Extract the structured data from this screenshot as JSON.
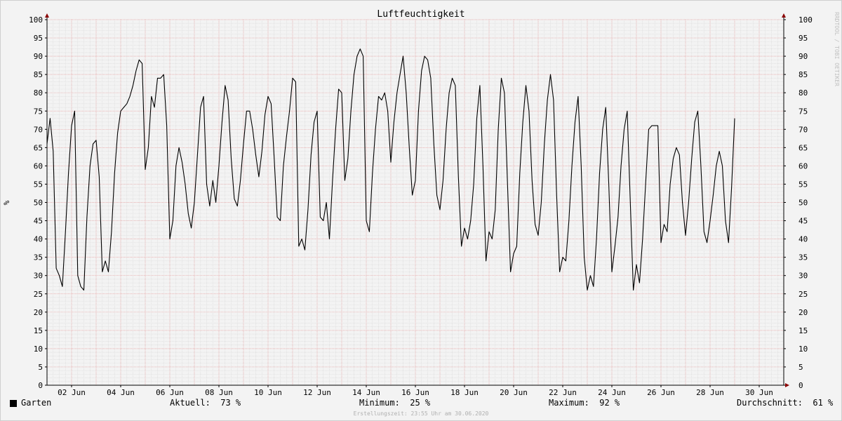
{
  "chart_data": {
    "type": "line",
    "title": "Luftfeuchtigkeit",
    "ylabel": "%",
    "watermark": "RRDTOOL / TOBI OETIKER",
    "ylim": [
      0,
      100
    ],
    "yticks": [
      0,
      5,
      10,
      15,
      20,
      25,
      30,
      35,
      40,
      45,
      50,
      55,
      60,
      65,
      70,
      75,
      80,
      85,
      90,
      95,
      100
    ],
    "xlim": [
      "2020-06-01 00:00",
      "2020-07-01 00:00"
    ],
    "xticks": [
      {
        "date": "2020-06-02",
        "label": "02 Jun"
      },
      {
        "date": "2020-06-04",
        "label": "04 Jun"
      },
      {
        "date": "2020-06-06",
        "label": "06 Jun"
      },
      {
        "date": "2020-06-08",
        "label": "08 Jun"
      },
      {
        "date": "2020-06-10",
        "label": "10 Jun"
      },
      {
        "date": "2020-06-12",
        "label": "12 Jun"
      },
      {
        "date": "2020-06-14",
        "label": "14 Jun"
      },
      {
        "date": "2020-06-16",
        "label": "16 Jun"
      },
      {
        "date": "2020-06-18",
        "label": "18 Jun"
      },
      {
        "date": "2020-06-20",
        "label": "20 Jun"
      },
      {
        "date": "2020-06-22",
        "label": "22 Jun"
      },
      {
        "date": "2020-06-24",
        "label": "24 Jun"
      },
      {
        "date": "2020-06-26",
        "label": "26 Jun"
      },
      {
        "date": "2020-06-28",
        "label": "28 Jun"
      },
      {
        "date": "2020-06-30",
        "label": "30 Jun"
      }
    ],
    "grid": true,
    "colors": {
      "line": "#000000",
      "minor_grid": "#d8d8d8",
      "major_grid": "#e8a0a0",
      "arrow": "#8b0000"
    },
    "series": [
      {
        "name": "Garten",
        "points": [
          [
            "2020-06-01 00:00",
            66
          ],
          [
            "2020-06-01 03:00",
            73
          ],
          [
            "2020-06-01 06:00",
            64
          ],
          [
            "2020-06-01 09:00",
            32
          ],
          [
            "2020-06-01 12:00",
            30
          ],
          [
            "2020-06-01 15:00",
            27
          ],
          [
            "2020-06-01 18:00",
            42
          ],
          [
            "2020-06-01 21:00",
            58
          ],
          [
            "2020-06-02 00:00",
            71
          ],
          [
            "2020-06-02 03:00",
            75
          ],
          [
            "2020-06-02 06:00",
            30
          ],
          [
            "2020-06-02 09:00",
            27
          ],
          [
            "2020-06-02 12:00",
            26
          ],
          [
            "2020-06-02 15:00",
            46
          ],
          [
            "2020-06-02 18:00",
            60
          ],
          [
            "2020-06-02 21:00",
            66
          ],
          [
            "2020-06-03 00:00",
            67
          ],
          [
            "2020-06-03 03:00",
            57
          ],
          [
            "2020-06-03 06:00",
            31
          ],
          [
            "2020-06-03 09:00",
            34
          ],
          [
            "2020-06-03 12:00",
            31
          ],
          [
            "2020-06-03 15:00",
            42
          ],
          [
            "2020-06-03 18:00",
            58
          ],
          [
            "2020-06-03 21:00",
            69
          ],
          [
            "2020-06-04 00:00",
            75
          ],
          [
            "2020-06-04 03:00",
            76
          ],
          [
            "2020-06-04 06:00",
            77
          ],
          [
            "2020-06-04 09:00",
            79
          ],
          [
            "2020-06-04 12:00",
            82
          ],
          [
            "2020-06-04 15:00",
            86
          ],
          [
            "2020-06-04 18:00",
            89
          ],
          [
            "2020-06-04 21:00",
            88
          ],
          [
            "2020-06-05 00:00",
            59
          ],
          [
            "2020-06-05 03:00",
            65
          ],
          [
            "2020-06-05 06:00",
            79
          ],
          [
            "2020-06-05 09:00",
            76
          ],
          [
            "2020-06-05 12:00",
            84
          ],
          [
            "2020-06-05 15:00",
            84
          ],
          [
            "2020-06-05 18:00",
            85
          ],
          [
            "2020-06-05 21:00",
            71
          ],
          [
            "2020-06-06 00:00",
            40
          ],
          [
            "2020-06-06 03:00",
            45
          ],
          [
            "2020-06-06 06:00",
            60
          ],
          [
            "2020-06-06 09:00",
            65
          ],
          [
            "2020-06-06 12:00",
            61
          ],
          [
            "2020-06-06 15:00",
            55
          ],
          [
            "2020-06-06 18:00",
            47
          ],
          [
            "2020-06-06 21:00",
            43
          ],
          [
            "2020-06-07 00:00",
            50
          ],
          [
            "2020-06-07 03:00",
            63
          ],
          [
            "2020-06-07 06:00",
            76
          ],
          [
            "2020-06-07 09:00",
            79
          ],
          [
            "2020-06-07 12:00",
            55
          ],
          [
            "2020-06-07 15:00",
            49
          ],
          [
            "2020-06-07 18:00",
            56
          ],
          [
            "2020-06-07 21:00",
            50
          ],
          [
            "2020-06-08 00:00",
            60
          ],
          [
            "2020-06-08 03:00",
            72
          ],
          [
            "2020-06-08 06:00",
            82
          ],
          [
            "2020-06-08 09:00",
            78
          ],
          [
            "2020-06-08 12:00",
            62
          ],
          [
            "2020-06-08 15:00",
            51
          ],
          [
            "2020-06-08 18:00",
            49
          ],
          [
            "2020-06-08 21:00",
            56
          ],
          [
            "2020-06-09 00:00",
            66
          ],
          [
            "2020-06-09 03:00",
            75
          ],
          [
            "2020-06-09 06:00",
            75
          ],
          [
            "2020-06-09 09:00",
            70
          ],
          [
            "2020-06-09 12:00",
            63
          ],
          [
            "2020-06-09 15:00",
            57
          ],
          [
            "2020-06-09 18:00",
            64
          ],
          [
            "2020-06-09 21:00",
            74
          ],
          [
            "2020-06-10 00:00",
            79
          ],
          [
            "2020-06-10 03:00",
            77
          ],
          [
            "2020-06-10 06:00",
            62
          ],
          [
            "2020-06-10 09:00",
            46
          ],
          [
            "2020-06-10 12:00",
            45
          ],
          [
            "2020-06-10 15:00",
            60
          ],
          [
            "2020-06-10 18:00",
            68
          ],
          [
            "2020-06-10 21:00",
            75
          ],
          [
            "2020-06-11 00:00",
            84
          ],
          [
            "2020-06-11 03:00",
            83
          ],
          [
            "2020-06-11 06:00",
            38
          ],
          [
            "2020-06-11 09:00",
            40
          ],
          [
            "2020-06-11 12:00",
            37
          ],
          [
            "2020-06-11 15:00",
            48
          ],
          [
            "2020-06-11 18:00",
            63
          ],
          [
            "2020-06-11 21:00",
            72
          ],
          [
            "2020-06-12 00:00",
            75
          ],
          [
            "2020-06-12 03:00",
            46
          ],
          [
            "2020-06-12 06:00",
            45
          ],
          [
            "2020-06-12 09:00",
            50
          ],
          [
            "2020-06-12 12:00",
            40
          ],
          [
            "2020-06-12 15:00",
            56
          ],
          [
            "2020-06-12 18:00",
            70
          ],
          [
            "2020-06-12 21:00",
            81
          ],
          [
            "2020-06-13 00:00",
            80
          ],
          [
            "2020-06-13 03:00",
            56
          ],
          [
            "2020-06-13 06:00",
            62
          ],
          [
            "2020-06-13 09:00",
            75
          ],
          [
            "2020-06-13 12:00",
            85
          ],
          [
            "2020-06-13 15:00",
            90
          ],
          [
            "2020-06-13 18:00",
            92
          ],
          [
            "2020-06-13 21:00",
            90
          ],
          [
            "2020-06-14 00:00",
            45
          ],
          [
            "2020-06-14 03:00",
            42
          ],
          [
            "2020-06-14 06:00",
            58
          ],
          [
            "2020-06-14 09:00",
            70
          ],
          [
            "2020-06-14 12:00",
            79
          ],
          [
            "2020-06-14 15:00",
            78
          ],
          [
            "2020-06-14 18:00",
            80
          ],
          [
            "2020-06-14 21:00",
            75
          ],
          [
            "2020-06-15 00:00",
            61
          ],
          [
            "2020-06-15 03:00",
            72
          ],
          [
            "2020-06-15 06:00",
            80
          ],
          [
            "2020-06-15 09:00",
            85
          ],
          [
            "2020-06-15 12:00",
            90
          ],
          [
            "2020-06-15 15:00",
            80
          ],
          [
            "2020-06-15 18:00",
            65
          ],
          [
            "2020-06-15 21:00",
            52
          ],
          [
            "2020-06-16 00:00",
            56
          ],
          [
            "2020-06-16 03:00",
            75
          ],
          [
            "2020-06-16 06:00",
            86
          ],
          [
            "2020-06-16 09:00",
            90
          ],
          [
            "2020-06-16 12:00",
            89
          ],
          [
            "2020-06-16 15:00",
            84
          ],
          [
            "2020-06-16 18:00",
            66
          ],
          [
            "2020-06-16 21:00",
            52
          ],
          [
            "2020-06-17 00:00",
            48
          ],
          [
            "2020-06-17 03:00",
            56
          ],
          [
            "2020-06-17 06:00",
            70
          ],
          [
            "2020-06-17 09:00",
            80
          ],
          [
            "2020-06-17 12:00",
            84
          ],
          [
            "2020-06-17 15:00",
            82
          ],
          [
            "2020-06-17 18:00",
            57
          ],
          [
            "2020-06-17 21:00",
            38
          ],
          [
            "2020-06-18 00:00",
            43
          ],
          [
            "2020-06-18 03:00",
            40
          ],
          [
            "2020-06-18 06:00",
            45
          ],
          [
            "2020-06-18 09:00",
            55
          ],
          [
            "2020-06-18 12:00",
            73
          ],
          [
            "2020-06-18 15:00",
            82
          ],
          [
            "2020-06-18 18:00",
            60
          ],
          [
            "2020-06-18 21:00",
            34
          ],
          [
            "2020-06-19 00:00",
            42
          ],
          [
            "2020-06-19 03:00",
            40
          ],
          [
            "2020-06-19 06:00",
            48
          ],
          [
            "2020-06-19 09:00",
            70
          ],
          [
            "2020-06-19 12:00",
            84
          ],
          [
            "2020-06-19 15:00",
            80
          ],
          [
            "2020-06-19 18:00",
            55
          ],
          [
            "2020-06-19 21:00",
            31
          ],
          [
            "2020-06-20 00:00",
            36
          ],
          [
            "2020-06-20 03:00",
            38
          ],
          [
            "2020-06-20 06:00",
            58
          ],
          [
            "2020-06-20 09:00",
            72
          ],
          [
            "2020-06-20 12:00",
            82
          ],
          [
            "2020-06-20 15:00",
            75
          ],
          [
            "2020-06-20 18:00",
            56
          ],
          [
            "2020-06-20 21:00",
            44
          ],
          [
            "2020-06-21 00:00",
            41
          ],
          [
            "2020-06-21 03:00",
            50
          ],
          [
            "2020-06-21 06:00",
            66
          ],
          [
            "2020-06-21 09:00",
            78
          ],
          [
            "2020-06-21 12:00",
            85
          ],
          [
            "2020-06-21 15:00",
            78
          ],
          [
            "2020-06-21 18:00",
            52
          ],
          [
            "2020-06-21 21:00",
            31
          ],
          [
            "2020-06-22 00:00",
            35
          ],
          [
            "2020-06-22 03:00",
            34
          ],
          [
            "2020-06-22 06:00",
            45
          ],
          [
            "2020-06-22 09:00",
            60
          ],
          [
            "2020-06-22 12:00",
            72
          ],
          [
            "2020-06-22 15:00",
            79
          ],
          [
            "2020-06-22 18:00",
            60
          ],
          [
            "2020-06-22 21:00",
            35
          ],
          [
            "2020-06-23 00:00",
            26
          ],
          [
            "2020-06-23 03:00",
            30
          ],
          [
            "2020-06-23 06:00",
            27
          ],
          [
            "2020-06-23 09:00",
            40
          ],
          [
            "2020-06-23 12:00",
            58
          ],
          [
            "2020-06-23 15:00",
            70
          ],
          [
            "2020-06-23 18:00",
            76
          ],
          [
            "2020-06-23 21:00",
            55
          ],
          [
            "2020-06-24 00:00",
            31
          ],
          [
            "2020-06-24 03:00",
            38
          ],
          [
            "2020-06-24 06:00",
            46
          ],
          [
            "2020-06-24 09:00",
            60
          ],
          [
            "2020-06-24 12:00",
            70
          ],
          [
            "2020-06-24 15:00",
            75
          ],
          [
            "2020-06-24 18:00",
            50
          ],
          [
            "2020-06-24 21:00",
            26
          ],
          [
            "2020-06-25 00:00",
            33
          ],
          [
            "2020-06-25 03:00",
            28
          ],
          [
            "2020-06-25 06:00",
            40
          ],
          [
            "2020-06-25 09:00",
            55
          ],
          [
            "2020-06-25 12:00",
            70
          ],
          [
            "2020-06-25 15:00",
            71
          ],
          [
            "2020-06-25 18:00",
            71
          ],
          [
            "2020-06-25 21:00",
            71
          ],
          [
            "2020-06-26 00:00",
            39
          ],
          [
            "2020-06-26 03:00",
            44
          ],
          [
            "2020-06-26 06:00",
            42
          ],
          [
            "2020-06-26 09:00",
            55
          ],
          [
            "2020-06-26 12:00",
            62
          ],
          [
            "2020-06-26 15:00",
            65
          ],
          [
            "2020-06-26 18:00",
            63
          ],
          [
            "2020-06-26 21:00",
            50
          ],
          [
            "2020-06-27 00:00",
            41
          ],
          [
            "2020-06-27 03:00",
            50
          ],
          [
            "2020-06-27 06:00",
            62
          ],
          [
            "2020-06-27 09:00",
            72
          ],
          [
            "2020-06-27 12:00",
            75
          ],
          [
            "2020-06-27 15:00",
            60
          ],
          [
            "2020-06-27 18:00",
            42
          ],
          [
            "2020-06-27 21:00",
            39
          ],
          [
            "2020-06-28 00:00",
            45
          ],
          [
            "2020-06-28 03:00",
            52
          ],
          [
            "2020-06-28 06:00",
            60
          ],
          [
            "2020-06-28 09:00",
            64
          ],
          [
            "2020-06-28 12:00",
            60
          ],
          [
            "2020-06-28 15:00",
            45
          ],
          [
            "2020-06-28 18:00",
            39
          ],
          [
            "2020-06-28 21:00",
            54
          ],
          [
            "2020-06-29 00:00",
            73
          ]
        ]
      }
    ]
  },
  "legend": {
    "series_name": "Garten",
    "current_label": "Aktuell:",
    "current_value": "73 %",
    "min_label": "Minimum:",
    "min_value": "25 %",
    "max_label": "Maximum:",
    "max_value": "92 %",
    "avg_label": "Durchschnitt:",
    "avg_value": "61 %"
  },
  "footer": "Erstellungszeit: 23:55 Uhr am 30.06.2020"
}
